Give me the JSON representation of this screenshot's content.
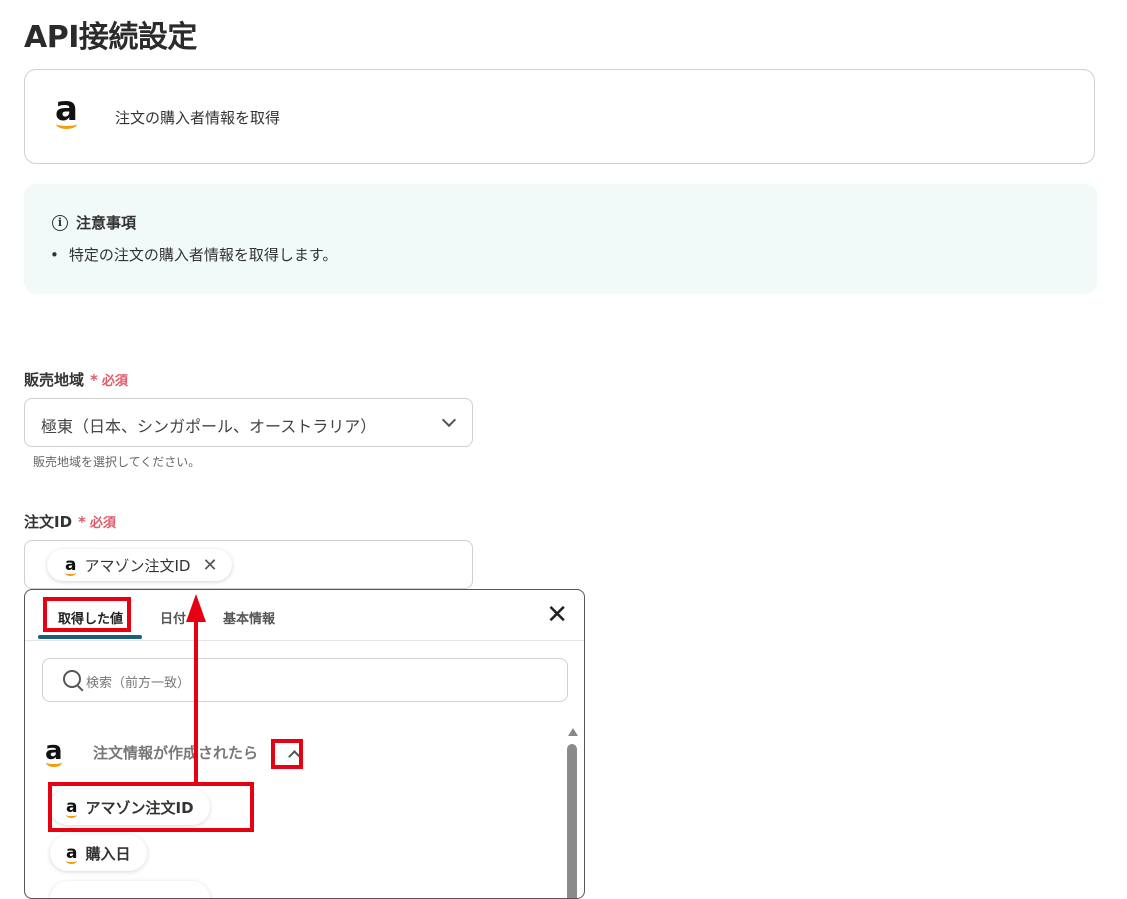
{
  "page": {
    "title": "API接続設定"
  },
  "app_card": {
    "icon": "amazon-logo",
    "action_label": "注文の購入者情報を取得"
  },
  "notice": {
    "heading": "注意事項",
    "items": [
      "特定の注文の購入者情報を取得します。"
    ]
  },
  "fields": {
    "region": {
      "label": "販売地域",
      "required_mark": "*",
      "required_text": "必須",
      "value": "極東（日本、シンガポール、オーストラリア）",
      "help": "販売地域を選択してください。"
    },
    "order_id": {
      "label": "注文ID",
      "required_mark": "*",
      "required_text": "必須",
      "chip_label": "アマゾン注文ID"
    }
  },
  "picker": {
    "tabs": [
      {
        "label": "取得した値",
        "active": true
      },
      {
        "label": "日付"
      },
      {
        "label": "基本情報"
      }
    ],
    "search_placeholder": "検索（前方一致）",
    "group": {
      "label": "注文情報が作成されたら",
      "expanded": true
    },
    "items": [
      {
        "label": "アマゾン注文ID"
      },
      {
        "label": "購入日"
      }
    ]
  },
  "colors": {
    "accent_tab": "#1b5f7a",
    "required": "#e05a6a",
    "notice_bg": "#f1faf8",
    "annotation_red": "#e60012",
    "amazon_orange": "#f39c12"
  }
}
